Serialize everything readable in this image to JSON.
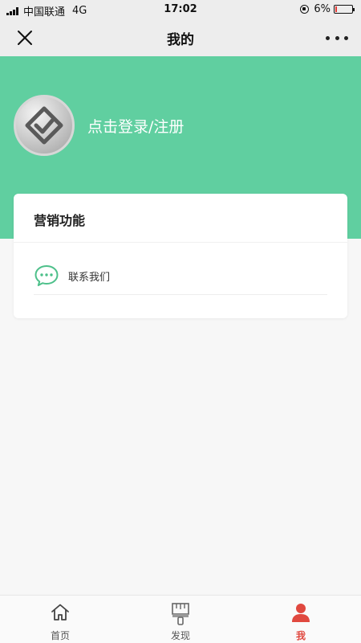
{
  "status_bar": {
    "carrier": "中国联通",
    "network": "4G",
    "time": "17:02",
    "battery": "6%",
    "battery_level": 0.06,
    "battery_color": "#e53935"
  },
  "nav": {
    "title": "我的",
    "close_icon": "close-icon",
    "more_icon": "more-icon"
  },
  "header": {
    "background": "#60cfa0",
    "avatar_icon": "diamond-check-icon",
    "login_text": "点击登录/注册"
  },
  "card": {
    "title": "营销功能",
    "items": [
      {
        "label": "联系我们",
        "icon": "chat-bubble-icon"
      }
    ]
  },
  "tabs": [
    {
      "label": "首页",
      "icon": "home-icon",
      "active": false
    },
    {
      "label": "发现",
      "icon": "brush-icon",
      "active": false
    },
    {
      "label": "我",
      "icon": "user-icon",
      "active": true
    }
  ],
  "colors": {
    "accent": "#60cfa0",
    "active_tab": "#e0483f"
  }
}
